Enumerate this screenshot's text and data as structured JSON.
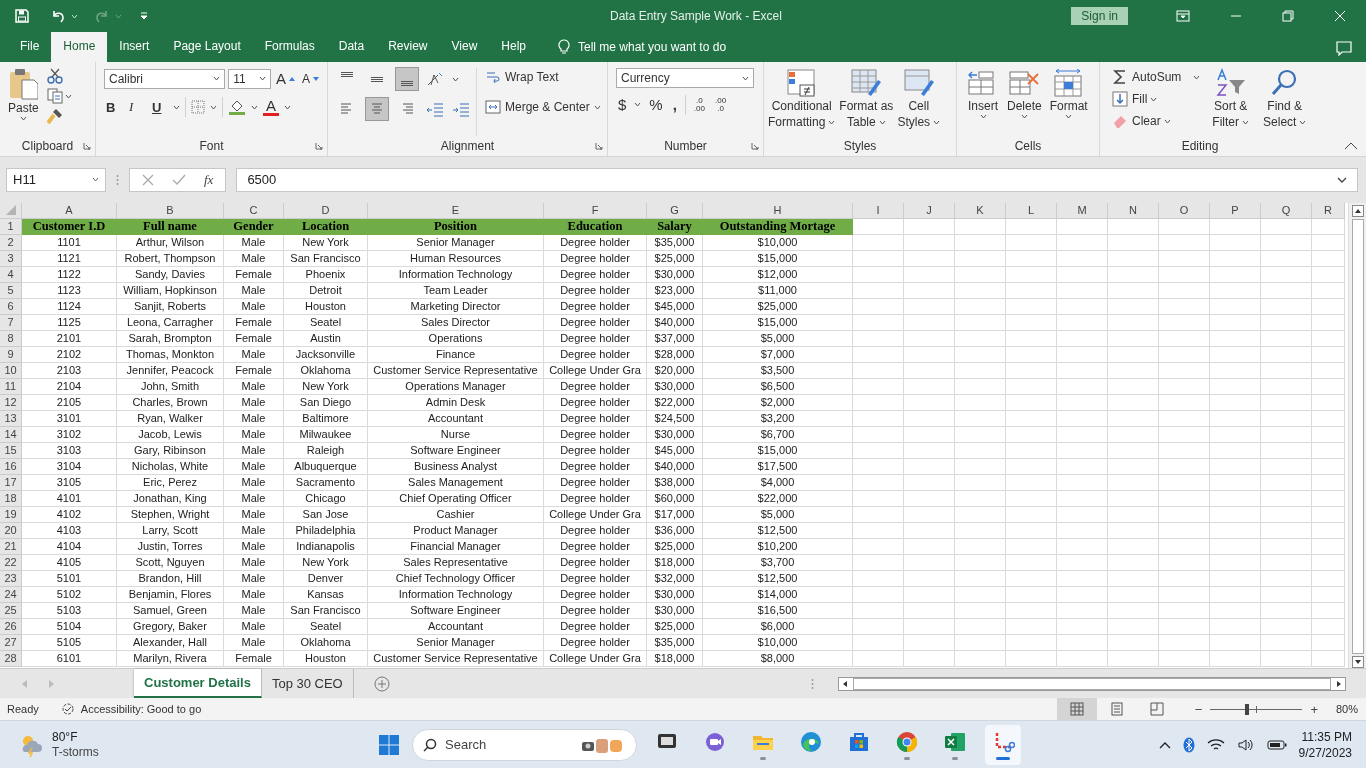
{
  "title_bar": {
    "title": "Data Entry Sample Work  -  Excel",
    "sign_in": "Sign in"
  },
  "menu_tabs": [
    {
      "label": "File",
      "selected": false
    },
    {
      "label": "Home",
      "selected": true
    },
    {
      "label": "Insert",
      "selected": false
    },
    {
      "label": "Page Layout",
      "selected": false
    },
    {
      "label": "Formulas",
      "selected": false
    },
    {
      "label": "Data",
      "selected": false
    },
    {
      "label": "Review",
      "selected": false
    },
    {
      "label": "View",
      "selected": false
    },
    {
      "label": "Help",
      "selected": false
    }
  ],
  "tell_me": "Tell me what you want to do",
  "ribbon": {
    "clipboard": {
      "label": "Clipboard",
      "paste": "Paste"
    },
    "font": {
      "label": "Font",
      "font_name": "Calibri",
      "font_size": "11",
      "grow": "A",
      "shrink": "A",
      "bold": "B",
      "italic": "I",
      "underline": "U",
      "font_color": "A"
    },
    "alignment": {
      "label": "Alignment",
      "wrap_text": "Wrap Text",
      "merge": "Merge & Center",
      "vertical": [
        {
          "selected": false
        },
        {
          "selected": false
        },
        {
          "selected": true
        }
      ],
      "horizontal": [
        {
          "selected": false
        },
        {
          "selected": true
        },
        {
          "selected": false
        }
      ]
    },
    "number": {
      "label": "Number",
      "format": "Currency",
      "currency": "$",
      "percent": "%",
      "comma": ",",
      "decimals": [
        {
          "top": ".0",
          "bottom": ".00"
        },
        {
          "top": ".00",
          "bottom": ".0"
        }
      ]
    },
    "styles": {
      "label": "Styles",
      "buttons": [
        {
          "line1": "Conditional",
          "line2": "Formatting"
        },
        {
          "line1": "Format as",
          "line2": "Table"
        },
        {
          "line1": "Cell",
          "line2": "Styles"
        }
      ]
    },
    "cells": {
      "label": "Cells",
      "buttons": [
        "Insert",
        "Delete",
        "Format"
      ]
    },
    "editing": {
      "label": "Editing",
      "autosum": "AutoSum",
      "fill": "Fill",
      "clear": "Clear",
      "sort": {
        "line1": "Sort &",
        "line2": "Filter"
      },
      "find": {
        "line1": "Find &",
        "line2": "Select"
      }
    }
  },
  "formula_bar": {
    "name_box": "H11",
    "fx": "fx",
    "value": "6500"
  },
  "sheet": {
    "columns": [
      "A",
      "B",
      "C",
      "D",
      "E",
      "F",
      "G",
      "H",
      "I",
      "J",
      "K",
      "L",
      "M",
      "N",
      "O",
      "P",
      "Q",
      "R"
    ],
    "header_row_number": "1",
    "header": [
      "Customer I.D",
      "Full name",
      "Gender",
      "Location",
      "Position",
      "Education",
      "Salary",
      "Outstanding Mortage"
    ],
    "rows": [
      {
        "number": "2",
        "cells": [
          "1101",
          "Arthur, Wilson",
          "Male",
          "New York",
          "Senior Manager",
          "Degree holder",
          "$35,000",
          "$10,000"
        ]
      },
      {
        "number": "3",
        "cells": [
          "1121",
          "Robert, Thompson",
          "Male",
          "San Francisco",
          "Human Resources",
          "Degree holder",
          "$25,000",
          "$15,000"
        ]
      },
      {
        "number": "4",
        "cells": [
          "1122",
          "Sandy, Davies",
          "Female",
          "Phoenix",
          "Information Technology",
          "Degree holder",
          "$30,000",
          "$12,000"
        ]
      },
      {
        "number": "5",
        "cells": [
          "1123",
          "William, Hopkinson",
          "Male",
          "Detroit",
          "Team Leader",
          "Degree holder",
          "$23,000",
          "$11,000"
        ]
      },
      {
        "number": "6",
        "cells": [
          "1124",
          "Sanjit, Roberts",
          "Male",
          "Houston",
          "Marketing Director",
          "Degree holder",
          "$45,000",
          "$25,000"
        ]
      },
      {
        "number": "7",
        "cells": [
          "1125",
          "Leona, Carragher",
          "Female",
          "Seatel",
          "Sales Director",
          "Degree holder",
          "$40,000",
          "$15,000"
        ]
      },
      {
        "number": "8",
        "cells": [
          "2101",
          "Sarah, Brompton",
          "Female",
          "Austin",
          "Operations",
          "Degree holder",
          "$37,000",
          "$5,000"
        ]
      },
      {
        "number": "9",
        "cells": [
          "2102",
          "Thomas, Monkton",
          "Male",
          "Jacksonville",
          "Finance",
          "Degree holder",
          "$28,000",
          "$7,000"
        ]
      },
      {
        "number": "10",
        "cells": [
          "2103",
          "Jennifer, Peacock",
          "Female",
          "Oklahoma",
          "Customer Service Representative",
          "College Under Gra",
          "$20,000",
          "$3,500"
        ]
      },
      {
        "number": "11",
        "cells": [
          "2104",
          "John, Smith",
          "Male",
          "New York",
          "Operations Manager",
          "Degree holder",
          "$30,000",
          "$6,500"
        ]
      },
      {
        "number": "12",
        "cells": [
          "2105",
          "Charles, Brown",
          "Male",
          "San Diego",
          "Admin Desk",
          "Degree holder",
          "$22,000",
          "$2,000"
        ]
      },
      {
        "number": "13",
        "cells": [
          "3101",
          "Ryan, Walker",
          "Male",
          "Baltimore",
          "Accountant",
          "Degree holder",
          "$24,500",
          "$3,200"
        ]
      },
      {
        "number": "14",
        "cells": [
          "3102",
          "Jacob, Lewis",
          "Male",
          "Milwaukee",
          "Nurse",
          "Degree holder",
          "$30,000",
          "$6,700"
        ]
      },
      {
        "number": "15",
        "cells": [
          "3103",
          "Gary, Ribinson",
          "Male",
          "Raleigh",
          "Software Engineer",
          "Degree holder",
          "$45,000",
          "$15,000"
        ]
      },
      {
        "number": "16",
        "cells": [
          "3104",
          "Nicholas, White",
          "Male",
          "Albuquerque",
          "Business Analyst",
          "Degree holder",
          "$40,000",
          "$17,500"
        ]
      },
      {
        "number": "17",
        "cells": [
          "3105",
          "Eric, Perez",
          "Male",
          "Sacramento",
          "Sales Management",
          "Degree holder",
          "$38,000",
          "$4,000"
        ]
      },
      {
        "number": "18",
        "cells": [
          "4101",
          "Jonathan, King",
          "Male",
          "Chicago",
          "Chief Operating Officer",
          "Degree holder",
          "$60,000",
          "$22,000"
        ]
      },
      {
        "number": "19",
        "cells": [
          "4102",
          "Stephen, Wright",
          "Male",
          "San Jose",
          "Cashier",
          "College Under Gra",
          "$17,000",
          "$5,000"
        ]
      },
      {
        "number": "20",
        "cells": [
          "4103",
          "Larry, Scott",
          "Male",
          "Philadelphia",
          "Product Manager",
          "Degree holder",
          "$36,000",
          "$12,500"
        ]
      },
      {
        "number": "21",
        "cells": [
          "4104",
          "Justin, Torres",
          "Male",
          "Indianapolis",
          "Financial Manager",
          "Degree holder",
          "$25,000",
          "$10,200"
        ]
      },
      {
        "number": "22",
        "cells": [
          "4105",
          "Scott, Nguyen",
          "Male",
          "New York",
          "Sales Representative",
          "Degree holder",
          "$18,000",
          "$3,700"
        ]
      },
      {
        "number": "23",
        "cells": [
          "5101",
          "Brandon, Hill",
          "Male",
          "Denver",
          "Chief Technology Officer",
          "Degree holder",
          "$32,000",
          "$12,500"
        ]
      },
      {
        "number": "24",
        "cells": [
          "5102",
          "Benjamin, Flores",
          "Male",
          "Kansas",
          "Information Technology",
          "Degree holder",
          "$30,000",
          "$14,000"
        ]
      },
      {
        "number": "25",
        "cells": [
          "5103",
          "Samuel, Green",
          "Male",
          "San Francisco",
          "Software Engineer",
          "Degree holder",
          "$30,000",
          "$16,500"
        ]
      },
      {
        "number": "26",
        "cells": [
          "5104",
          "Gregory, Baker",
          "Male",
          "Seatel",
          "Accountant",
          "Degree holder",
          "$25,000",
          "$6,000"
        ]
      },
      {
        "number": "27",
        "cells": [
          "5105",
          "Alexander, Hall",
          "Male",
          "Oklahoma",
          "Senior Manager",
          "Degree holder",
          "$35,000",
          "$10,000"
        ]
      },
      {
        "number": "28",
        "cells": [
          "6101",
          "Marilyn, Rivera",
          "Female",
          "Houston",
          "Customer Service Representative",
          "College Under Gra",
          "$18,000",
          "$8,000"
        ]
      }
    ]
  },
  "sheet_tabs": [
    {
      "label": "Customer Details",
      "selected": true
    },
    {
      "label": "Top 30 CEO",
      "selected": false
    }
  ],
  "status_bar": {
    "ready": "Ready",
    "accessibility": "Accessibility: Good to go",
    "views": [
      {
        "selected": true
      },
      {
        "selected": false
      },
      {
        "selected": false
      }
    ],
    "zoom_out": "−",
    "zoom_in": "+",
    "zoom_slider": {
      "level": 0.4
    },
    "zoom": "80%"
  },
  "taskbar": {
    "weather": {
      "temperature": "80°F",
      "condition": "T-storms"
    },
    "search": "Search",
    "apps": [
      {
        "kind": "gallery",
        "running": false,
        "selected": false
      },
      {
        "kind": "meet",
        "running": false,
        "selected": false
      },
      {
        "kind": "explorer",
        "running": true,
        "selected": false
      },
      {
        "kind": "edge",
        "running": false,
        "selected": false
      },
      {
        "kind": "store",
        "running": false,
        "selected": false
      },
      {
        "kind": "chrome",
        "running": true,
        "selected": false
      },
      {
        "kind": "excel",
        "running": true,
        "selected": false
      },
      {
        "kind": "snipping",
        "running": true,
        "selected": true
      }
    ],
    "time": "11:35 PM",
    "date": "9/27/2023"
  }
}
